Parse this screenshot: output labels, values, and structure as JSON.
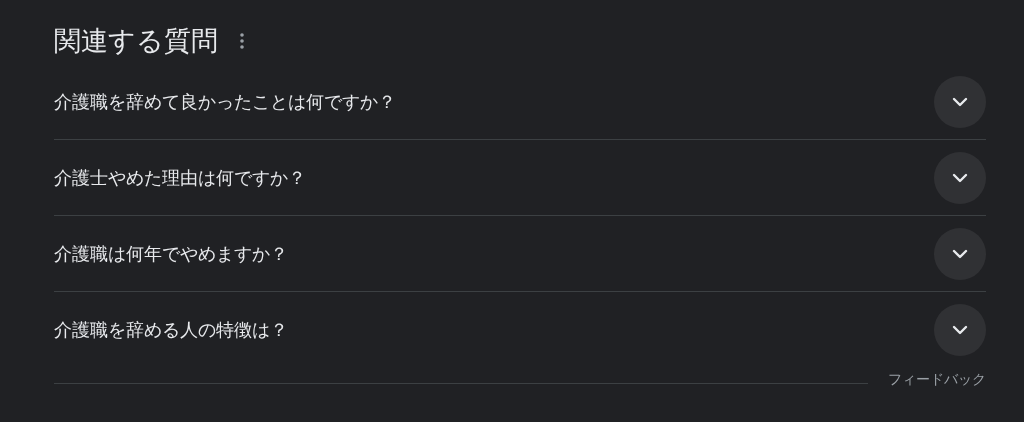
{
  "title": "関連する質問",
  "questions": [
    {
      "text": "介護職を辞めて良かったことは何ですか？",
      "expanded": false
    },
    {
      "text": "介護士やめた理由は何ですか？",
      "expanded": false
    },
    {
      "text": "介護職は何年でやめますか？",
      "expanded": false
    },
    {
      "text": "介護職を辞める人の特徴は？",
      "expanded": false
    }
  ],
  "feedback": "フィードバック"
}
